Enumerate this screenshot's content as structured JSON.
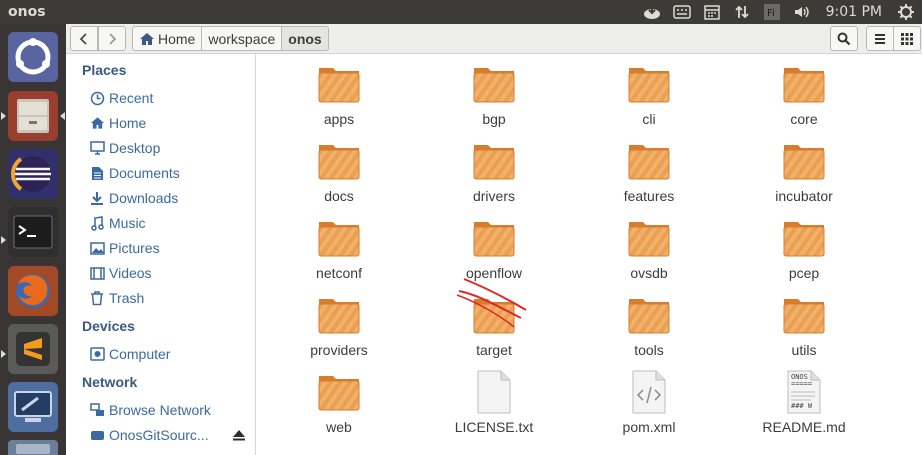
{
  "window": {
    "title": "onos"
  },
  "panel": {
    "clock": "9:01 PM"
  },
  "breadcrumbs": [
    "Home",
    "workspace",
    "onos"
  ],
  "sidebar": {
    "places_heading": "Places",
    "places": [
      {
        "label": "Recent",
        "icon": "recent-icon"
      },
      {
        "label": "Home",
        "icon": "home-icon"
      },
      {
        "label": "Desktop",
        "icon": "desktop-icon"
      },
      {
        "label": "Documents",
        "icon": "documents-icon"
      },
      {
        "label": "Downloads",
        "icon": "downloads-icon"
      },
      {
        "label": "Music",
        "icon": "music-icon"
      },
      {
        "label": "Pictures",
        "icon": "pictures-icon"
      },
      {
        "label": "Videos",
        "icon": "videos-icon"
      },
      {
        "label": "Trash",
        "icon": "trash-icon"
      }
    ],
    "devices_heading": "Devices",
    "devices": [
      {
        "label": "Computer",
        "icon": "computer-icon"
      }
    ],
    "network_heading": "Network",
    "network": [
      {
        "label": "Browse Network",
        "icon": "network-icon"
      },
      {
        "label": "OnosGitSourc...",
        "icon": "drive-icon"
      }
    ]
  },
  "files": [
    {
      "name": "apps",
      "type": "folder"
    },
    {
      "name": "bgp",
      "type": "folder"
    },
    {
      "name": "cli",
      "type": "folder"
    },
    {
      "name": "core",
      "type": "folder"
    },
    {
      "name": "docs",
      "type": "folder"
    },
    {
      "name": "drivers",
      "type": "folder"
    },
    {
      "name": "features",
      "type": "folder"
    },
    {
      "name": "incubator",
      "type": "folder"
    },
    {
      "name": "netconf",
      "type": "folder"
    },
    {
      "name": "openflow",
      "type": "folder"
    },
    {
      "name": "ovsdb",
      "type": "folder"
    },
    {
      "name": "pcep",
      "type": "folder"
    },
    {
      "name": "providers",
      "type": "folder"
    },
    {
      "name": "target",
      "type": "folder"
    },
    {
      "name": "tools",
      "type": "folder"
    },
    {
      "name": "utils",
      "type": "folder"
    },
    {
      "name": "web",
      "type": "folder"
    },
    {
      "name": "LICENSE.txt",
      "type": "text"
    },
    {
      "name": "pom.xml",
      "type": "xml"
    },
    {
      "name": "README.md",
      "type": "markdown"
    }
  ],
  "readme_preview": [
    "ONOS",
    "=====",
    "### W"
  ],
  "colors": {
    "folder_light": "#f2b168",
    "folder_dark": "#d77d2e",
    "accent": "#3a6aa0",
    "panel": "#3c3b37",
    "launcher": "#383534"
  }
}
